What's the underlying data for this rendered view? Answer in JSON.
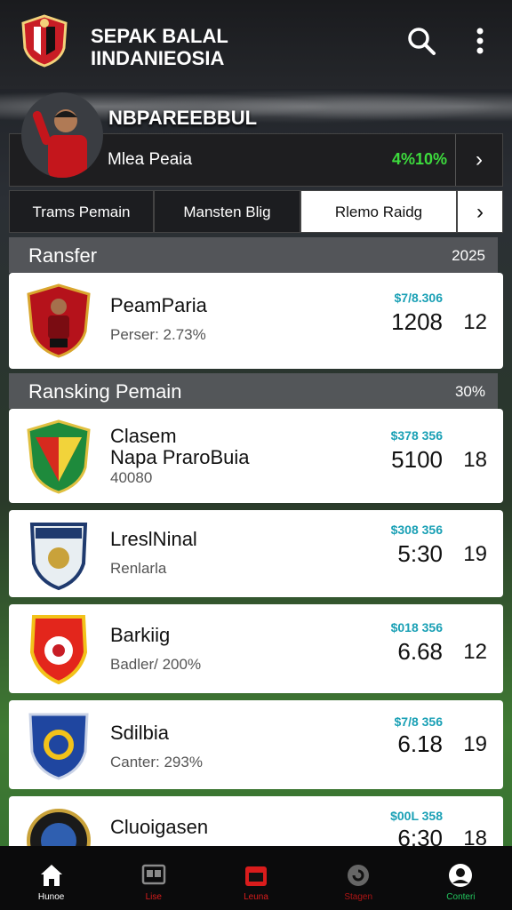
{
  "header": {
    "title_line1": "SEPAK BALAL",
    "title_line2": "IINDANIEOSIA",
    "icons": [
      "search-icon",
      "more-vertical-icon"
    ]
  },
  "hero": {
    "player_name": "NBPAREEBBUL",
    "subtitle": "Mlea Peaia",
    "percent": "4%10%",
    "arrow": "›"
  },
  "tabs": [
    {
      "label": "Trams Pemain",
      "active": false
    },
    {
      "label": "Mansten Blig",
      "active": false
    },
    {
      "label": "Rlemo Raidg",
      "active": true
    }
  ],
  "tabs_more": "›",
  "section1": {
    "title": "Ransfer",
    "right": "2025"
  },
  "section2": {
    "title": "Ransking Pemain",
    "right": "30%"
  },
  "cards": [
    {
      "name": "PeamParia",
      "name2": "",
      "sub": "Perser: 2.73%",
      "money": "$7/8.306",
      "big": "1208",
      "num": "12"
    },
    {
      "name": "Clasem",
      "name2": "Napa PraroBuia",
      "sub": "40080",
      "money": "$378 356",
      "big": "5100",
      "num": "18"
    },
    {
      "name": "LreslNinal",
      "name2": "",
      "sub": "Renlarla",
      "money": "$308 356",
      "big": "5:30",
      "num": "19"
    },
    {
      "name": "Barkiig",
      "name2": "",
      "sub": "Badler/ 200%",
      "money": "$018 356",
      "big": "6.68",
      "num": "12"
    },
    {
      "name": "Sdilbia",
      "name2": "",
      "sub": "Canter: 293%",
      "money": "$7/8 356",
      "big": "6.18",
      "num": "19"
    },
    {
      "name": "Cluoigasen",
      "name2": "",
      "sub": "",
      "money": "$00L 358",
      "big": "6:30",
      "num": "18"
    }
  ],
  "nav": [
    {
      "label": "Hunoe",
      "color": "#ffffff",
      "icon": "home-icon"
    },
    {
      "label": "Lise",
      "color": "#d91c1c",
      "icon": "scoreboard-icon"
    },
    {
      "label": "Leuna",
      "color": "#d91c1c",
      "icon": "calendar-icon"
    },
    {
      "label": "Stagen",
      "color": "#b01515",
      "icon": "refresh-icon"
    },
    {
      "label": "Conteri",
      "color": "#22c55e",
      "icon": "profile-icon"
    }
  ],
  "colors": {
    "accent_green": "#3ddc3d",
    "money": "#1aa0b5",
    "brand_red": "#d91c1c"
  }
}
